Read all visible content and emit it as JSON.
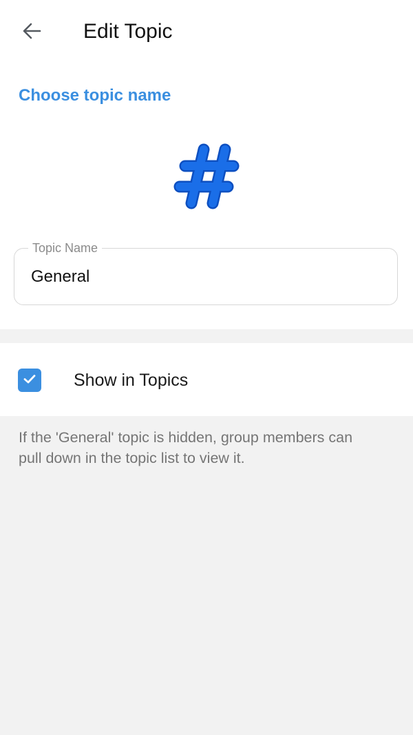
{
  "header": {
    "title": "Edit Topic",
    "back_icon": "arrow-left-icon"
  },
  "topic": {
    "section_heading": "Choose topic name",
    "icon": "hashtag-icon",
    "icon_color": "#1a6ee8",
    "name_field": {
      "label": "Topic Name",
      "value": "General"
    }
  },
  "visibility": {
    "label": "Show in Topics",
    "checked": true,
    "hint": "If the 'General' topic is hidden, group members can\npull down in the topic list to view it."
  },
  "colors": {
    "accent": "#3b8fe0",
    "background": "#f2f2f2",
    "surface": "#ffffff"
  }
}
